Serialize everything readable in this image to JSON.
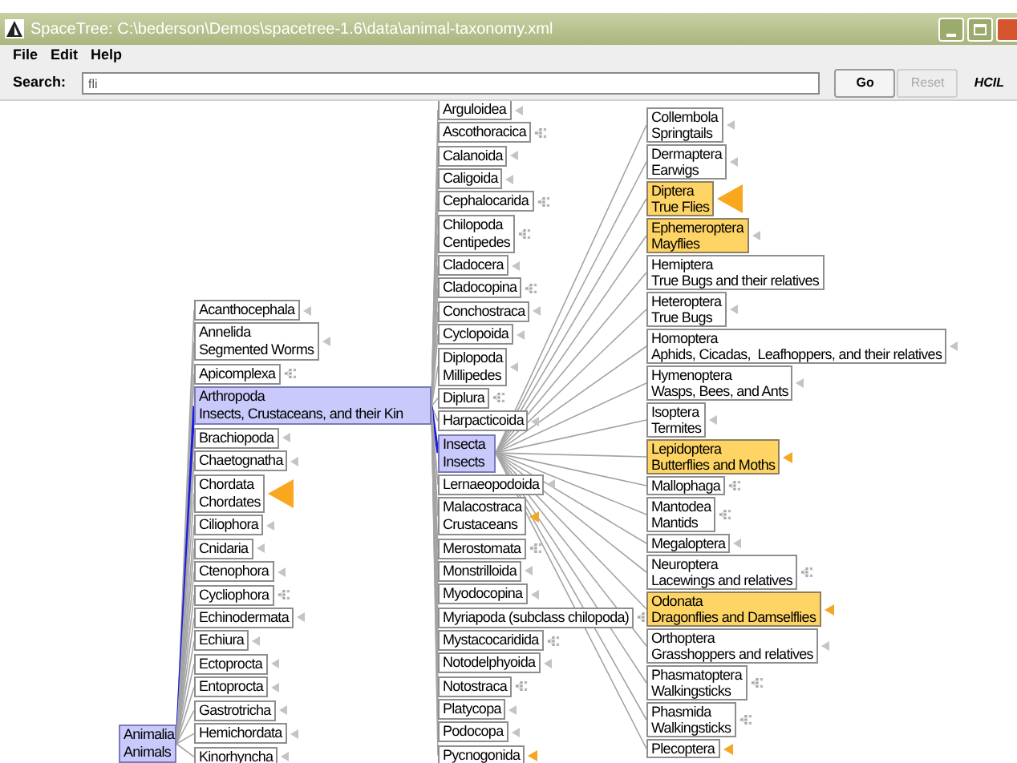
{
  "window": {
    "title": "SpaceTree: C:\\bederson\\Demos\\spacetree-1.6\\data\\animal-taxonomy.xml"
  },
  "menu": [
    "File",
    "Edit",
    "Help"
  ],
  "search": {
    "label": "Search:",
    "value": "fli"
  },
  "buttons": [
    {
      "label": "Go",
      "disabled": false
    },
    {
      "label": "Reset",
      "disabled": true
    }
  ],
  "logo": {
    "text": "HCIL"
  },
  "tree": {
    "root": {
      "lines": [
        "Animalia",
        "Animals"
      ],
      "selected": true,
      "highlighted": false
    },
    "columns": [
      {
        "nodes": [
          {
            "lines": [
              "Acanthocephala"
            ],
            "selected": false,
            "highlighted": false,
            "kind": "stub"
          },
          {
            "lines": [
              "Annelida",
              "Segmented Worms"
            ],
            "selected": false,
            "highlighted": false,
            "kind": "stub"
          },
          {
            "lines": [
              "Apicomplexa"
            ],
            "selected": false,
            "highlighted": false,
            "kind": "subtree"
          },
          {
            "lines": [
              "Arthropoda",
              "Insects, Crustaceans, and their Kin"
            ],
            "selected": true,
            "highlighted": false,
            "kind": "plain"
          },
          {
            "lines": [
              "Brachiopoda"
            ],
            "selected": false,
            "highlighted": false,
            "kind": "stub"
          },
          {
            "lines": [
              "Chaetognatha"
            ],
            "selected": false,
            "highlighted": false,
            "kind": "stub"
          },
          {
            "lines": [
              "Chordata",
              "Chordates"
            ],
            "selected": false,
            "highlighted": false,
            "kind": "match-large"
          },
          {
            "lines": [
              "Ciliophora"
            ],
            "selected": false,
            "highlighted": false,
            "kind": "stub"
          },
          {
            "lines": [
              "Cnidaria"
            ],
            "selected": false,
            "highlighted": false,
            "kind": "stub"
          },
          {
            "lines": [
              "Ctenophora"
            ],
            "selected": false,
            "highlighted": false,
            "kind": "stub"
          },
          {
            "lines": [
              "Cycliophora"
            ],
            "selected": false,
            "highlighted": false,
            "kind": "subtree"
          },
          {
            "lines": [
              "Echinodermata"
            ],
            "selected": false,
            "highlighted": false,
            "kind": "stub"
          },
          {
            "lines": [
              "Echiura"
            ],
            "selected": false,
            "highlighted": false,
            "kind": "stub"
          },
          {
            "lines": [
              "Ectoprocta"
            ],
            "selected": false,
            "highlighted": false,
            "kind": "stub"
          },
          {
            "lines": [
              "Entoprocta"
            ],
            "selected": false,
            "highlighted": false,
            "kind": "stub"
          },
          {
            "lines": [
              "Gastrotricha"
            ],
            "selected": false,
            "highlighted": false,
            "kind": "stub"
          },
          {
            "lines": [
              "Hemichordata"
            ],
            "selected": false,
            "highlighted": false,
            "kind": "stub"
          },
          {
            "lines": [
              "Kinorhyncha"
            ],
            "selected": false,
            "highlighted": false,
            "kind": "stub"
          }
        ]
      },
      {
        "nodes": [
          {
            "lines": [
              "Arguloidea"
            ],
            "selected": false,
            "highlighted": false,
            "kind": "stub"
          },
          {
            "lines": [
              "Ascothoracica"
            ],
            "selected": false,
            "highlighted": false,
            "kind": "subtree"
          },
          {
            "lines": [
              "Calanoida"
            ],
            "selected": false,
            "highlighted": false,
            "kind": "stub"
          },
          {
            "lines": [
              "Caligoida"
            ],
            "selected": false,
            "highlighted": false,
            "kind": "stub"
          },
          {
            "lines": [
              "Cephalocarida"
            ],
            "selected": false,
            "highlighted": false,
            "kind": "subtree"
          },
          {
            "lines": [
              "Chilopoda",
              "Centipedes"
            ],
            "selected": false,
            "highlighted": false,
            "kind": "subtree"
          },
          {
            "lines": [
              "Cladocera"
            ],
            "selected": false,
            "highlighted": false,
            "kind": "stub"
          },
          {
            "lines": [
              "Cladocopina"
            ],
            "selected": false,
            "highlighted": false,
            "kind": "subtree"
          },
          {
            "lines": [
              "Conchostraca"
            ],
            "selected": false,
            "highlighted": false,
            "kind": "stub"
          },
          {
            "lines": [
              "Cyclopoida"
            ],
            "selected": false,
            "highlighted": false,
            "kind": "stub"
          },
          {
            "lines": [
              "Diplopoda",
              "Millipedes"
            ],
            "selected": false,
            "highlighted": false,
            "kind": "stub"
          },
          {
            "lines": [
              "Diplura"
            ],
            "selected": false,
            "highlighted": false,
            "kind": "subtree"
          },
          {
            "lines": [
              "Harpacticoida"
            ],
            "selected": false,
            "highlighted": false,
            "kind": "stub"
          },
          {
            "lines": [
              "Insecta",
              "Insects"
            ],
            "selected": true,
            "highlighted": false,
            "kind": "plain"
          },
          {
            "lines": [
              "Lernaeopodoida"
            ],
            "selected": false,
            "highlighted": false,
            "kind": "stub"
          },
          {
            "lines": [
              "Malacostraca",
              "Crustaceans"
            ],
            "selected": false,
            "highlighted": false,
            "kind": "match"
          },
          {
            "lines": [
              "Merostomata"
            ],
            "selected": false,
            "highlighted": false,
            "kind": "subtree"
          },
          {
            "lines": [
              "Monstrilloida"
            ],
            "selected": false,
            "highlighted": false,
            "kind": "stub"
          },
          {
            "lines": [
              "Myodocopina"
            ],
            "selected": false,
            "highlighted": false,
            "kind": "stub"
          },
          {
            "lines": [
              "Myriapoda (subclass chilopoda)"
            ],
            "selected": false,
            "highlighted": false,
            "kind": "subtree"
          },
          {
            "lines": [
              "Mystacocaridida"
            ],
            "selected": false,
            "highlighted": false,
            "kind": "subtree"
          },
          {
            "lines": [
              "Notodelphyoida"
            ],
            "selected": false,
            "highlighted": false,
            "kind": "stub"
          },
          {
            "lines": [
              "Notostraca"
            ],
            "selected": false,
            "highlighted": false,
            "kind": "subtree"
          },
          {
            "lines": [
              "Platycopa"
            ],
            "selected": false,
            "highlighted": false,
            "kind": "stub"
          },
          {
            "lines": [
              "Podocopa"
            ],
            "selected": false,
            "highlighted": false,
            "kind": "stub"
          },
          {
            "lines": [
              "Pycnogonida"
            ],
            "selected": false,
            "highlighted": false,
            "kind": "match"
          }
        ]
      },
      {
        "nodes": [
          {
            "lines": [
              "Collembola",
              "Springtails"
            ],
            "selected": false,
            "highlighted": false,
            "kind": "stub"
          },
          {
            "lines": [
              "Dermaptera",
              "Earwigs"
            ],
            "selected": false,
            "highlighted": false,
            "kind": "stub"
          },
          {
            "lines": [
              "Diptera",
              "True Flies"
            ],
            "selected": false,
            "highlighted": true,
            "kind": "match-large"
          },
          {
            "lines": [
              "Ephemeroptera",
              "Mayflies"
            ],
            "selected": false,
            "highlighted": true,
            "kind": "stub"
          },
          {
            "lines": [
              "Hemiptera",
              "True Bugs and their relatives"
            ],
            "selected": false,
            "highlighted": false,
            "kind": "plain"
          },
          {
            "lines": [
              "Heteroptera",
              "True Bugs"
            ],
            "selected": false,
            "highlighted": false,
            "kind": "stub"
          },
          {
            "lines": [
              "Homoptera",
              "Aphids, Cicadas,  Leafhoppers, and their relatives"
            ],
            "selected": false,
            "highlighted": false,
            "kind": "stub"
          },
          {
            "lines": [
              "Hymenoptera",
              "Wasps, Bees, and Ants"
            ],
            "selected": false,
            "highlighted": false,
            "kind": "stub"
          },
          {
            "lines": [
              "Isoptera",
              "Termites"
            ],
            "selected": false,
            "highlighted": false,
            "kind": "stub"
          },
          {
            "lines": [
              "Lepidoptera",
              "Butterflies and Moths"
            ],
            "selected": false,
            "highlighted": true,
            "kind": "match"
          },
          {
            "lines": [
              "Mallophaga"
            ],
            "selected": false,
            "highlighted": false,
            "kind": "subtree"
          },
          {
            "lines": [
              "Mantodea",
              "Mantids"
            ],
            "selected": false,
            "highlighted": false,
            "kind": "subtree"
          },
          {
            "lines": [
              "Megaloptera"
            ],
            "selected": false,
            "highlighted": false,
            "kind": "stub"
          },
          {
            "lines": [
              "Neuroptera",
              "Lacewings and relatives"
            ],
            "selected": false,
            "highlighted": false,
            "kind": "subtree"
          },
          {
            "lines": [
              "Odonata",
              "Dragonflies and Damselflies"
            ],
            "selected": false,
            "highlighted": true,
            "kind": "match"
          },
          {
            "lines": [
              "Orthoptera",
              "Grasshoppers and relatives"
            ],
            "selected": false,
            "highlighted": false,
            "kind": "stub"
          },
          {
            "lines": [
              "Phasmatoptera",
              "Walkingsticks"
            ],
            "selected": false,
            "highlighted": false,
            "kind": "subtree"
          },
          {
            "lines": [
              "Phasmida",
              "Walkingsticks"
            ],
            "selected": false,
            "highlighted": false,
            "kind": "subtree"
          },
          {
            "lines": [
              "Plecoptera"
            ],
            "selected": false,
            "highlighted": false,
            "kind": "match"
          }
        ]
      }
    ]
  }
}
